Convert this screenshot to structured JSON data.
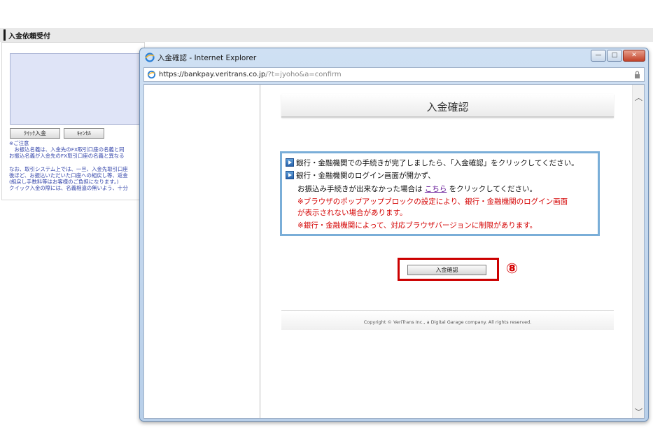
{
  "background_page": {
    "title": "入金依頼受付",
    "quick_deposit_button": "ｸｲｯｸ入金",
    "cancel_button": "ｷｬﾝｾﾙ",
    "notes_block1": "※ご注意\n　お振込名義は、入金先のFX取引口座の名義と同\nお振込名義が入金先のFX取引口座の名義と異なる",
    "notes_block2": "なお、取引システム上では、一旦、入金先取引口座\n後ほど、お振込いただいた口座への組戻し等、返金\n(組戻し手数料等はお客様のご負担になります。)\nクイック入金の際には、名義相違の無いよう、十分"
  },
  "window": {
    "title": "入金確認 - Internet Explorer",
    "controls": {
      "minimize": "—",
      "maximize": "□",
      "close": "✕"
    },
    "address": {
      "host": "https://bankpay.veritrans.co.jp",
      "path": "/?t=jyoho&a=confirm"
    }
  },
  "content": {
    "heading": "入金確認",
    "info_lines": [
      "銀行・金融機関での手続きが完了しましたら、「入金確認」をクリックしてください。",
      "銀行・金融機関のログイン画面が開かず、"
    ],
    "transfer_text_before": "お振込み手続きが出来なかった場合は ",
    "transfer_link": "こちら",
    "transfer_text_after": " をクリックしてください。",
    "popup_warning_1": "※ブラウザのポップアップブロックの設定により、銀行・金融機関のログイン画面",
    "popup_warning_2": "が表示されない場合があります。",
    "browser_warning": "※銀行・金融機関によって、対応ブラウザバージョンに制限があります。",
    "confirm_button": "入金確認",
    "step_marker": "⑧",
    "footer": "Copyright © VeriTrans Inc., a Digital Garage company. All rights reserved."
  },
  "scroll": {
    "up": "︿",
    "down": "﹀"
  },
  "colors": {
    "accent_blue": "#7aaed8",
    "warning_red": "#d40000",
    "highlight_frame": "#cc0000"
  }
}
